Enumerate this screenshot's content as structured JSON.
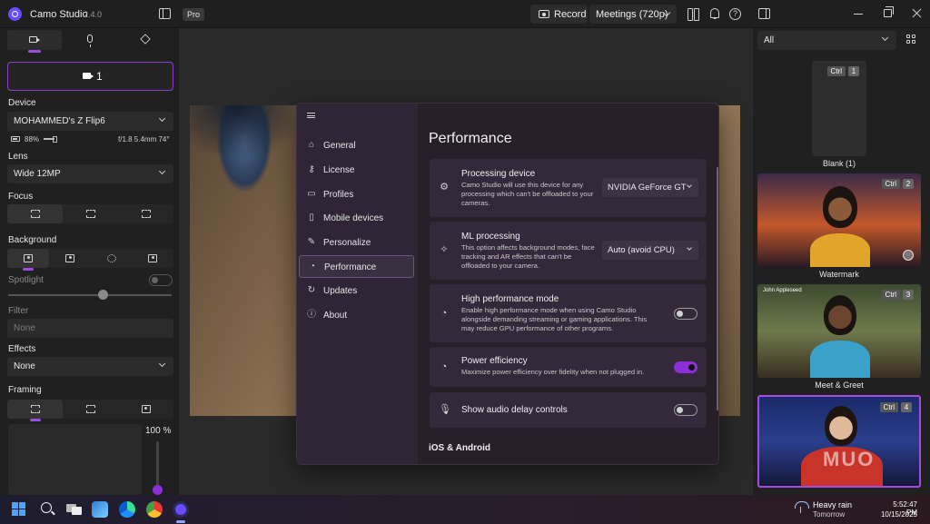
{
  "titlebar": {
    "app_name": "Camo Studio",
    "version": "2.4.0",
    "pro_badge": "Pro",
    "record_label": "Record",
    "preset_selected": "Meetings (720p)"
  },
  "left_panel": {
    "tabs": [
      "camera",
      "audio",
      "layers"
    ],
    "camera_number": "1",
    "device_label": "Device",
    "device_value": "MOHAMMED's Z Flip6",
    "battery": "88%",
    "lens_info": "f/1.8 5.4mm 74°",
    "lens_label": "Lens",
    "lens_value": "Wide 12MP",
    "focus_label": "Focus",
    "background_label": "Background",
    "spotlight_label": "Spotlight",
    "spotlight_level": 0.58,
    "filter_label": "Filter",
    "filter_value": "None",
    "effects_label": "Effects",
    "effects_value": "None",
    "framing_label": "Framing",
    "zoom_value": "100 %"
  },
  "scenes": {
    "filter_value": "All",
    "items": [
      {
        "name": "Blank (1)",
        "ctrl": "Ctrl",
        "key": "1"
      },
      {
        "name": "Watermark",
        "ctrl": "Ctrl",
        "key": "2"
      },
      {
        "name": "Meet & Greet",
        "ctrl": "Ctrl",
        "key": "3",
        "tag": "John Appleseed"
      },
      {
        "name": "",
        "ctrl": "Ctrl",
        "key": "4",
        "overlay": "MUO"
      }
    ]
  },
  "settings": {
    "title": "Performance",
    "nav": [
      {
        "label": "General",
        "icon": "home-icon"
      },
      {
        "label": "License",
        "icon": "key-icon"
      },
      {
        "label": "Profiles",
        "icon": "monitor-icon"
      },
      {
        "label": "Mobile devices",
        "icon": "phone-icon"
      },
      {
        "label": "Personalize",
        "icon": "brush-icon"
      },
      {
        "label": "Performance",
        "icon": "gauge-icon"
      },
      {
        "label": "Updates",
        "icon": "refresh-icon"
      },
      {
        "label": "About",
        "icon": "info-icon"
      }
    ],
    "processing_device": {
      "title": "Processing device",
      "desc": "Camo Studio will use this device for any processing which can't be offloaded to your cameras.",
      "value": "NVIDIA GeForce GT"
    },
    "ml_processing": {
      "title": "ML processing",
      "desc": "This option affects background modes, face tracking and AR effects that can't be offloaded to your camera.",
      "value": "Auto (avoid CPU)"
    },
    "high_performance": {
      "title": "High performance mode",
      "desc": "Enable high performance mode when using Camo Studio alongside demanding streaming or gaming applications. This may reduce GPU performance of other programs.",
      "enabled": false
    },
    "power_efficiency": {
      "title": "Power efficiency",
      "desc": "Maximize power efficiency over fidelity when not plugged in.",
      "enabled": true
    },
    "audio_delay": {
      "title": "Show audio delay controls",
      "enabled": false
    },
    "section_ios": "iOS & Android"
  },
  "taskbar": {
    "weather_main": "Heavy rain",
    "weather_sub": "Tomorrow",
    "time": "5:52:47 PM",
    "date": "10/15/2025"
  },
  "colors": {
    "accent": "#8b2fd9",
    "modal_bg": "#282028"
  }
}
